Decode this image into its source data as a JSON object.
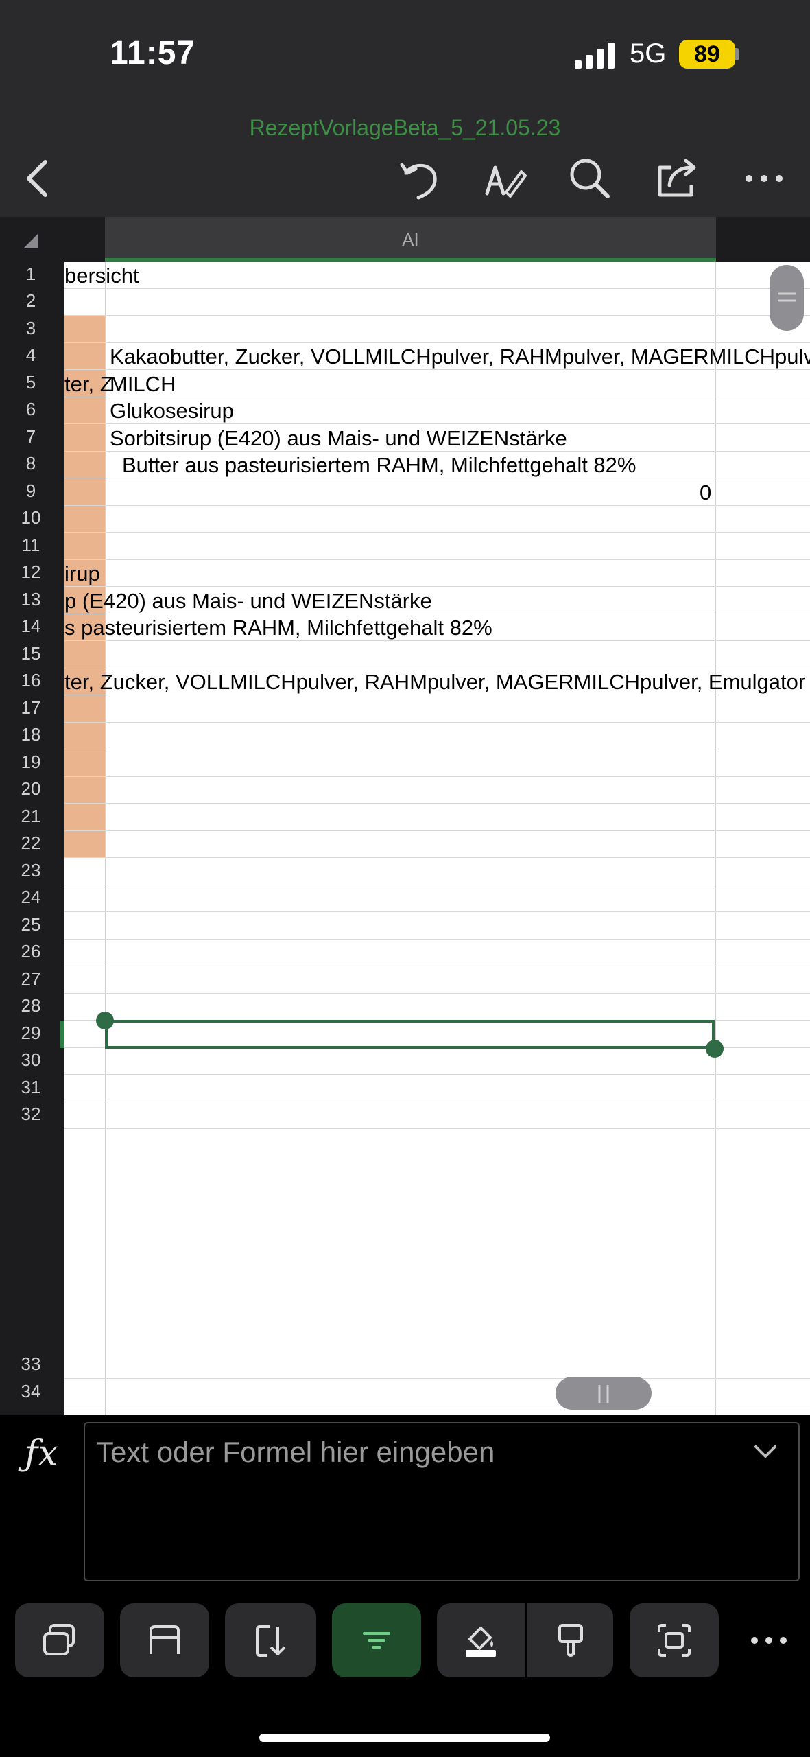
{
  "status": {
    "time": "11:57",
    "network": "5G",
    "battery": "89"
  },
  "document": {
    "title": "RezeptVorlageBeta_5_21.05.23"
  },
  "sheet": {
    "column_header": "AI",
    "row_numbers": [
      "1",
      "2",
      "3",
      "4",
      "5",
      "6",
      "7",
      "8",
      "9",
      "10",
      "11",
      "12",
      "13",
      "14",
      "15",
      "16",
      "17",
      "18",
      "19",
      "20",
      "21",
      "22",
      "23",
      "24",
      "25",
      "26",
      "27",
      "28",
      "29",
      "30",
      "31",
      "32",
      "33",
      "34"
    ],
    "cells": {
      "r1": "bersicht",
      "r4": "Kakaobutter, Zucker, VOLLMILCHpulver, RAHMpulver, MAGERMILCHpulver",
      "r5a": "ter, Z",
      "r5b": "MILCH",
      "r6": "Glukosesirup",
      "r7": "Sorbitsirup (E420) aus Mais- und WEIZENstärke",
      "r8": "Butter aus pasteurisiertem RAHM, Milchfettgehalt 82%",
      "r9": "0",
      "r12": "irup",
      "r13": "p (E420) aus Mais- und WEIZENstärke",
      "r14": "s pasteurisiertem RAHM, Milchfettgehalt 82%",
      "r16": "ter, Zucker, VOLLMILCHpulver, RAHMpulver, MAGERMILCHpulver, Emulgator"
    }
  },
  "formula_bar": {
    "placeholder": "Text oder Formel hier eingeben"
  },
  "colors": {
    "accent": "#2e7d43",
    "fill": "#eab48e"
  }
}
